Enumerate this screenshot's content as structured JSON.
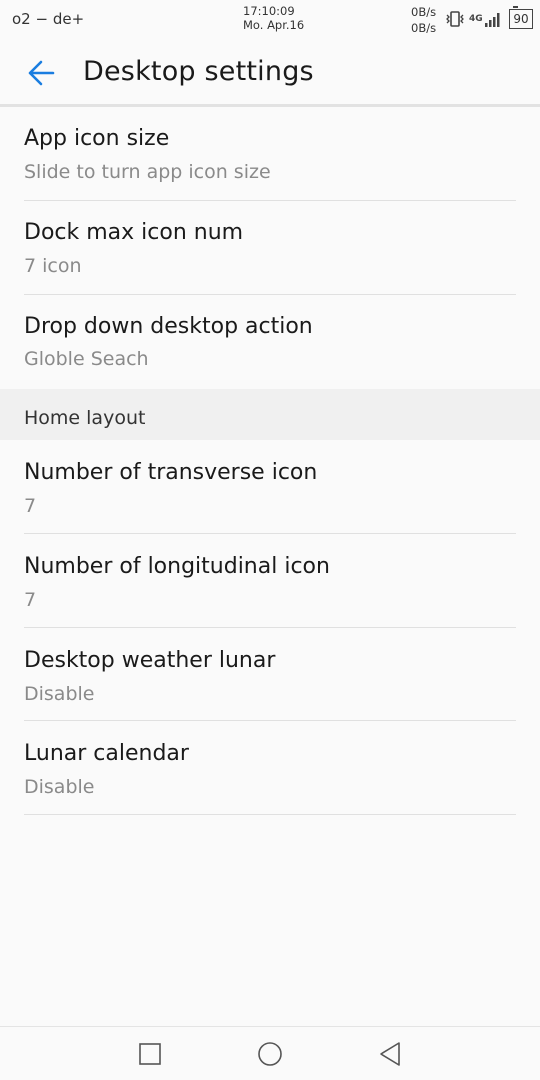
{
  "status_bar": {
    "carrier": "o2 − de+",
    "time": "17:10:09",
    "date": "Mo. Apr.16",
    "upload_speed": "0B/s",
    "download_speed": "0B/s",
    "network_type": "4G",
    "battery_level": "90",
    "icons": [
      "vibrate-icon",
      "network-4g-icon",
      "signal-icon",
      "battery-icon"
    ]
  },
  "app_bar": {
    "back_icon": "arrow-left-icon",
    "title": "Desktop settings",
    "accent_color": "#1a7de0"
  },
  "settings": [
    {
      "title": "App icon size",
      "subtitle": "Slide to turn app icon size"
    },
    {
      "title": "Dock max icon num",
      "subtitle": "7 icon"
    },
    {
      "title": "Drop down desktop action",
      "subtitle": "Globle Seach"
    }
  ],
  "home_layout": {
    "header": "Home layout",
    "items": [
      {
        "title": "Number of transverse icon",
        "subtitle": "7"
      },
      {
        "title": "Number of longitudinal icon",
        "subtitle": "7"
      },
      {
        "title": "Desktop weather lunar",
        "subtitle": "Disable"
      },
      {
        "title": "Lunar calendar",
        "subtitle": "Disable"
      }
    ]
  },
  "nav_bar": {
    "buttons": [
      "recent-apps-icon",
      "home-icon",
      "back-icon"
    ]
  }
}
